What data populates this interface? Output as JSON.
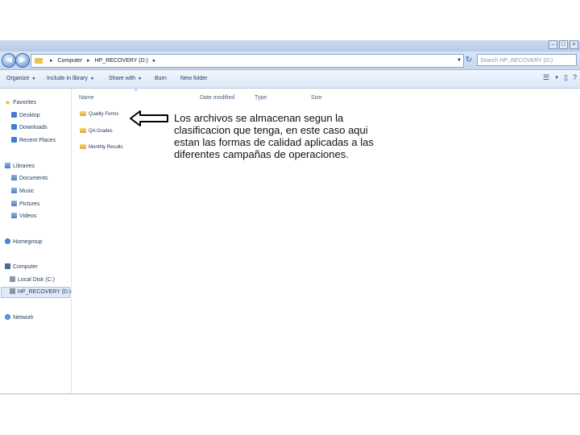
{
  "address": {
    "crumbs": [
      "Computer",
      "HP_RECOVERY (D:)"
    ],
    "search_placeholder": "Search HP_RECOVERY (D:)"
  },
  "toolbar": {
    "organize": "Organize",
    "include_in_library": "Include in library",
    "share_with": "Share with",
    "burn": "Burn",
    "new_folder": "New folder"
  },
  "sidebar": {
    "favorites": "Favorites",
    "desktop": "Desktop",
    "downloads": "Downloads",
    "recent_places": "Recent Places",
    "libraries": "Libraries",
    "documents": "Documents",
    "music": "Music",
    "pictures": "Pictures",
    "videos": "Videos",
    "homegroup": "Homegroup",
    "computer": "Computer",
    "local_disk": "Local Disk (C:)",
    "hp_recovery": "HP_RECOVERY (D:)",
    "network": "Network"
  },
  "columns": {
    "name": "Name",
    "date_modified": "Date modified",
    "type": "Type",
    "size": "Size"
  },
  "files": [
    "Quality Forms",
    "QA Grades",
    "Monthly Results"
  ],
  "annotation": "Los archivos se almacenan segun la clasificacion que tenga, en este caso aqui estan las formas de calidad aplicadas a las diferentes campañas de operaciones.",
  "colors": {
    "accent": "#3f7fd0",
    "folder": "#e7c35a"
  }
}
